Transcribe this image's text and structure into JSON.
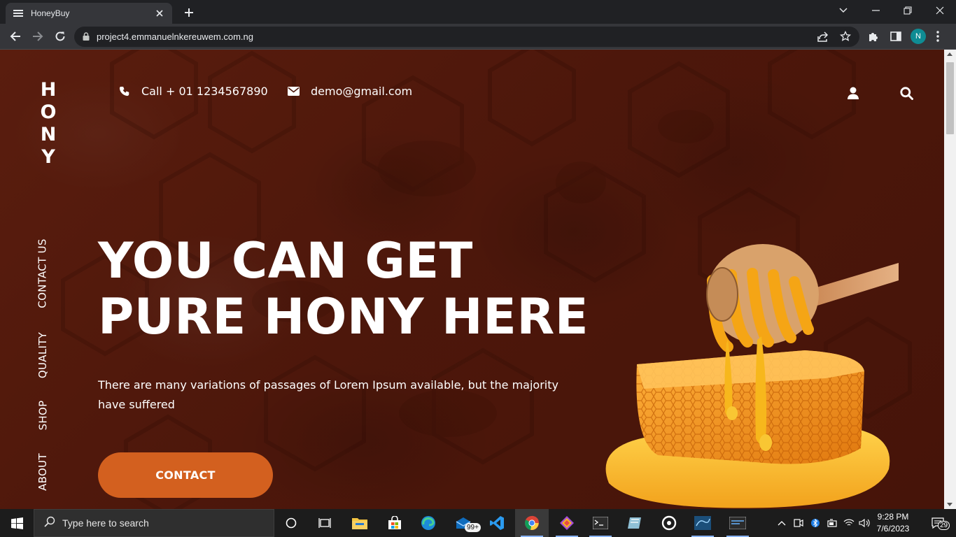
{
  "browser": {
    "tab_title": "HoneyBuy",
    "url": "project4.emmanuelnkereuwem.com.ng",
    "profile_initial": "N",
    "accent": "#0f8c94"
  },
  "site": {
    "logo_letters": [
      "H",
      "O",
      "N",
      "Y"
    ],
    "nav": [
      "CONTACT US",
      "QUALITY",
      "SHOP",
      "ABOUT"
    ],
    "phone": "Call + 01 1234567890",
    "email": "demo@gmail.com",
    "hero_line1": "YOU CAN GET",
    "hero_line2": "PURE HONY HERE",
    "hero_text": "There are many variations of passages of Lorem Ipsum available, but the majority have suffered",
    "cta_label": "CONTACT",
    "colors": {
      "background": "#4d170b",
      "cta": "#d3601f",
      "honey": "#f2a21c"
    },
    "icons": [
      "phone-icon",
      "envelope-icon",
      "user-icon",
      "search-icon"
    ]
  },
  "taskbar": {
    "search_placeholder": "Type here to search",
    "mail_badge": "99+",
    "time": "9:28 PM",
    "date": "7/6/2023",
    "notification_count": "29"
  }
}
